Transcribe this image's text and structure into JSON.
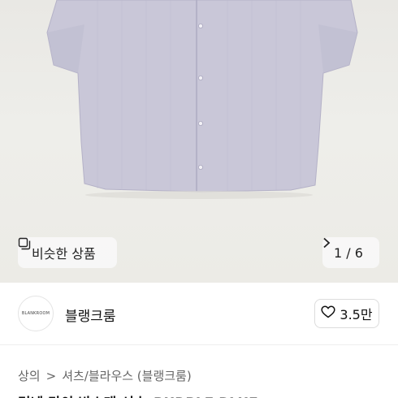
{
  "image": {
    "alt_icon": "shirt-photo"
  },
  "similar": {
    "icon": "similar-items-icon",
    "label": "비슷한 상품"
  },
  "pager": {
    "label": "1 / 6",
    "icon": "chevron-right-icon"
  },
  "seller": {
    "logo_text": "BLANKROOM",
    "name": "블랭크룸"
  },
  "like": {
    "icon": "heart-icon",
    "count": "3.5만"
  },
  "breadcrumb": {
    "items": [
      "상의",
      "셔츠/블라우스 (블랭크룸)"
    ],
    "separator": ">"
  },
  "product_title_peek": "린넨 라이 반소매 셔츠_PURPLE BLUE"
}
